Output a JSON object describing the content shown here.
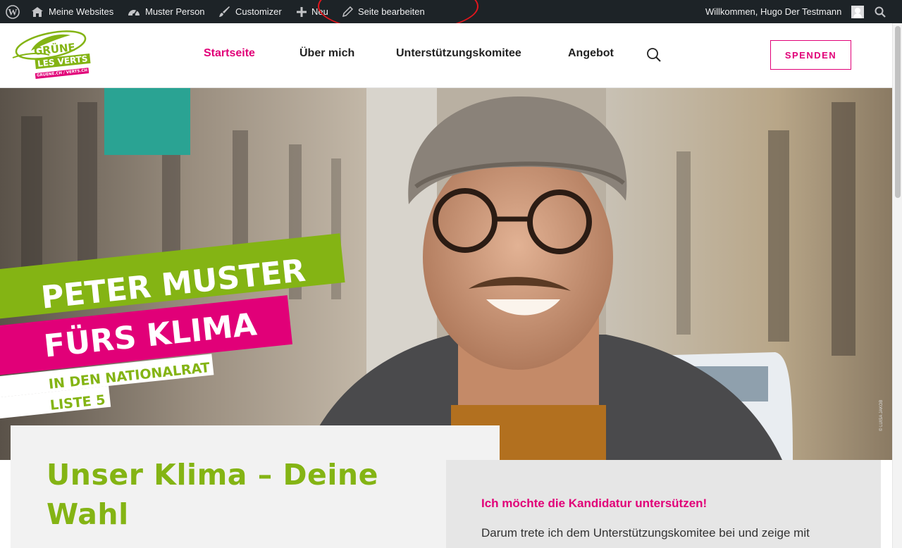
{
  "admin_bar": {
    "wp_logo": "wordpress-icon",
    "my_sites": "Meine Websites",
    "site_name": "Muster Person",
    "customizer": "Customizer",
    "new": "Neu",
    "edit_page": "Seite bearbeiten",
    "greeting": "Willkommen, Hugo Der Testmann"
  },
  "logo": {
    "line1": "GRÜNE",
    "line2": "LES VERTS",
    "url_text": "GRUENE.CH / VERTS.CH"
  },
  "nav": {
    "items": [
      {
        "label": "Startseite",
        "active": true
      },
      {
        "label": "Über mich",
        "active": false
      },
      {
        "label": "Unterstützungskomitee",
        "active": false
      },
      {
        "label": "Angebot",
        "active": false
      }
    ],
    "donate_button": "SPENDEN"
  },
  "hero": {
    "slogan_line1": "PETER MUSTER",
    "slogan_line2": "FÜRS KLIMA",
    "slogan_line3": "IN DEN NATIONALRAT",
    "slogan_line4": "LISTE 5",
    "photo_credit": "© LUISA JAKOB"
  },
  "content": {
    "headline": "Unser Klima – Deine Wahl",
    "support_title": "Ich möchte die Kandidatur untersützen!",
    "support_text": "Darum trete ich dem Unterstützungskomitee bei und zeige mit"
  },
  "colors": {
    "brand_green": "#84b414",
    "brand_magenta": "#e10078",
    "admin_bar": "#1d2327"
  }
}
